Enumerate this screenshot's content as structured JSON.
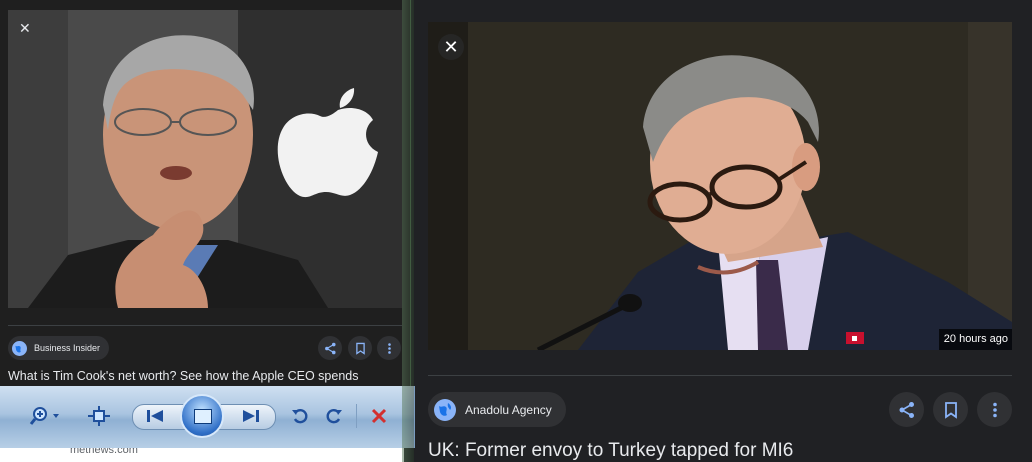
{
  "left_card": {
    "close_glyph": "✕",
    "source": "Business Insider",
    "headline": "What is Tim Cook's net worth? See how the Apple CEO spends",
    "icons": [
      "globe-icon",
      "share-icon",
      "bookmark-icon",
      "more-vert-icon"
    ]
  },
  "right_card": {
    "close_glyph": "✕",
    "time_badge": "20 hours ago",
    "source": "Anadolu Agency",
    "headline": "UK: Former envoy to Turkey tapped for MI6",
    "icons": [
      "globe-icon",
      "share-icon",
      "bookmark-icon",
      "more-vert-icon"
    ]
  },
  "viewer_toolbar": {
    "buttons": [
      "zoom-icon",
      "actual-size-icon",
      "previous-icon",
      "slideshow-icon",
      "next-icon",
      "rotate-ccw-icon",
      "rotate-cw-icon",
      "delete-icon"
    ]
  },
  "background_page": {
    "partial_text": "metnews.com"
  },
  "colors": {
    "accent": "#8ab4f8",
    "surface": "#202124",
    "chip": "#303134",
    "delete_red": "#d32f2f"
  }
}
